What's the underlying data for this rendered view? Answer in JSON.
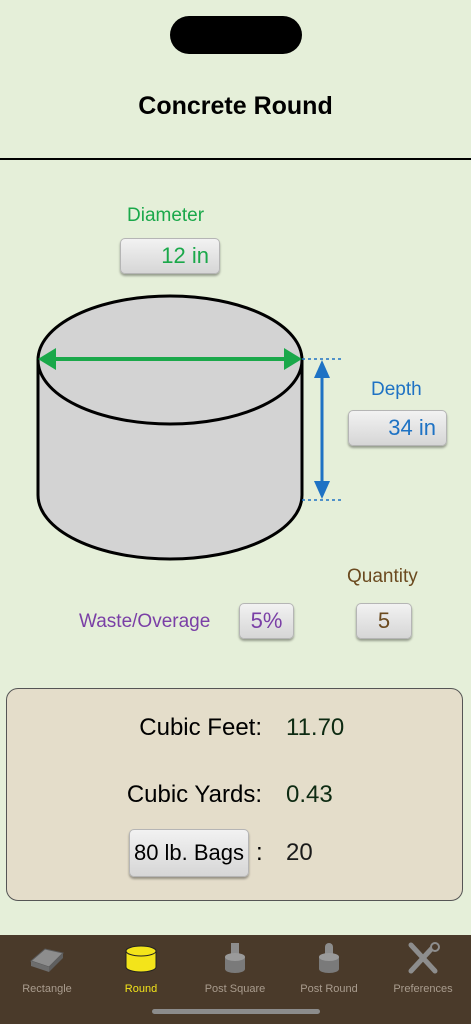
{
  "header": {
    "title": "Concrete Round"
  },
  "diameter": {
    "label": "Diameter",
    "value": "12 in"
  },
  "depth": {
    "label": "Depth",
    "value": "34 in"
  },
  "quantity": {
    "label": "Quantity",
    "value": "5"
  },
  "waste": {
    "label": "Waste/Overage",
    "value": "5%"
  },
  "results": {
    "cubic_feet_label": "Cubic Feet:",
    "cubic_feet_value": "11.70",
    "cubic_yards_label": "Cubic Yards:",
    "cubic_yards_value": "0.43",
    "bags_button": "80 lb. Bags",
    "bags_colon": ":",
    "bags_value": "20"
  },
  "tabs": [
    {
      "label": "Rectangle",
      "icon": "brick-icon",
      "active": false
    },
    {
      "label": "Round",
      "icon": "cylinder-icon",
      "active": true
    },
    {
      "label": "Post Square",
      "icon": "post-square-icon",
      "active": false
    },
    {
      "label": "Post Round",
      "icon": "post-round-icon",
      "active": false
    },
    {
      "label": "Preferences",
      "icon": "tools-icon",
      "active": false
    }
  ],
  "colors": {
    "background": "#e5efd9",
    "diameter": "#1aa84a",
    "depth": "#1e72c4",
    "quantity": "#6b4a1f",
    "waste": "#7a3fa6",
    "tab_active": "#f3e41a",
    "tab_inactive": "#a99c8e",
    "tabbar": "#4a3a2a"
  }
}
